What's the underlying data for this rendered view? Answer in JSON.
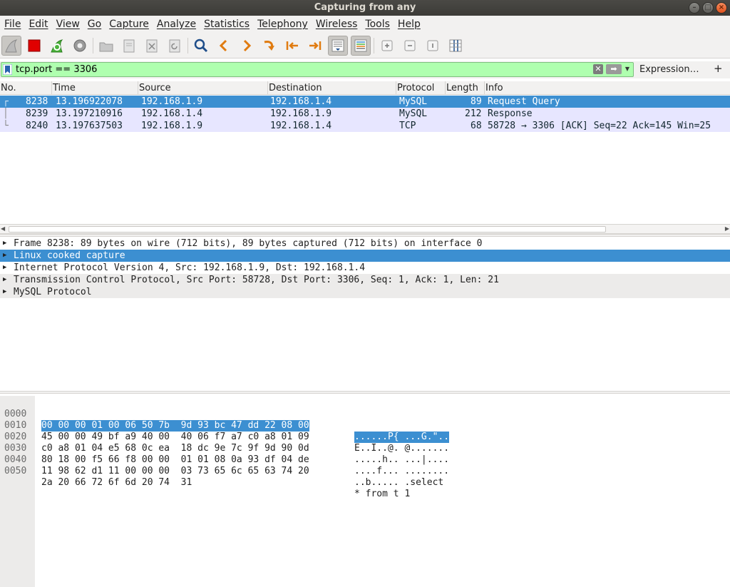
{
  "window": {
    "title": "Capturing from any"
  },
  "menu": [
    "File",
    "Edit",
    "View",
    "Go",
    "Capture",
    "Analyze",
    "Statistics",
    "Telephony",
    "Wireless",
    "Tools",
    "Help"
  ],
  "toolbar": {
    "icons": [
      "shark-fin-icon",
      "stop-icon",
      "restart-icon",
      "options-gear-icon",
      "open-file-icon",
      "save-file-icon",
      "close-file-icon",
      "reload-icon",
      "search-icon",
      "go-back-icon",
      "go-forward-icon",
      "go-to-packet-icon",
      "first-packet-icon",
      "last-packet-icon",
      "autoscroll-icon",
      "colorize-icon",
      "zoom-in-icon",
      "zoom-out-icon",
      "normal-size-icon",
      "resize-columns-icon"
    ]
  },
  "filter": {
    "value": "tcp.port == 3306",
    "background": "#afffaf",
    "expression_label": "Expression…",
    "add_label": "+"
  },
  "packet_list": {
    "columns": [
      "No.",
      "Time",
      "Source",
      "Destination",
      "Protocol",
      "Length",
      "Info"
    ],
    "rows": [
      {
        "no": "8238",
        "time": "13.196922078",
        "src": "192.168.1.9",
        "dst": "192.168.1.4",
        "proto": "MySQL",
        "len": "89",
        "info": "Request Query",
        "selected": true
      },
      {
        "no": "8239",
        "time": "13.197210916",
        "src": "192.168.1.4",
        "dst": "192.168.1.9",
        "proto": "MySQL",
        "len": "212",
        "info": "Response",
        "selected": false
      },
      {
        "no": "8240",
        "time": "13.197637503",
        "src": "192.168.1.9",
        "dst": "192.168.1.4",
        "proto": "TCP",
        "len": "68",
        "info": "58728 → 3306 [ACK] Seq=22 Ack=145 Win=25",
        "selected": false
      }
    ]
  },
  "details": [
    {
      "text": "Frame 8238: 89 bytes on wire (712 bits), 89 bytes captured (712 bits) on interface 0",
      "selected": false
    },
    {
      "text": "Linux cooked capture",
      "selected": true
    },
    {
      "text": "Internet Protocol Version 4, Src: 192.168.1.9, Dst: 192.168.1.4",
      "selected": false
    },
    {
      "text": "Transmission Control Protocol, Src Port: 58728, Dst Port: 3306, Seq: 1, Ack: 1, Len: 21",
      "selected": false
    },
    {
      "text": "MySQL Protocol",
      "selected": false
    }
  ],
  "bytes": [
    {
      "offset": "0000",
      "hex": "00 00 00 01 00 06 50 7b  9d 93 bc 47 dd 22 08 00",
      "ascii": "......P{ ...G.\"..",
      "highlight": true
    },
    {
      "offset": "0010",
      "hex": "45 00 00 49 bf a9 40 00  40 06 f7 a7 c0 a8 01 09",
      "ascii": "E..I..@. @.......",
      "highlight": false
    },
    {
      "offset": "0020",
      "hex": "c0 a8 01 04 e5 68 0c ea  18 dc 9e 7c 9f 9d 90 0d",
      "ascii": ".....h.. ...|....",
      "highlight": false
    },
    {
      "offset": "0030",
      "hex": "80 18 00 f5 66 f8 00 00  01 01 08 0a 93 df 04 de",
      "ascii": "....f... ........",
      "highlight": false
    },
    {
      "offset": "0040",
      "hex": "11 98 62 d1 11 00 00 00  03 73 65 6c 65 63 74 20",
      "ascii": "..b..... .select ",
      "highlight": false
    },
    {
      "offset": "0050",
      "hex": "2a 20 66 72 6f 6d 20 74  31",
      "ascii": "* from t 1",
      "highlight": false
    }
  ],
  "colors": {
    "selection": "#3c8fd1",
    "tcp_row": "#e7e6ff"
  }
}
